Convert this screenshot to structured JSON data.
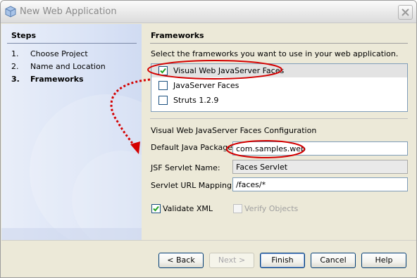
{
  "window": {
    "title": "New Web Application"
  },
  "steps": {
    "heading": "Steps",
    "items": [
      {
        "number": "1.",
        "label": "Choose Project",
        "current": false
      },
      {
        "number": "2.",
        "label": "Name and Location",
        "current": false
      },
      {
        "number": "3.",
        "label": "Frameworks",
        "current": true
      }
    ]
  },
  "frameworks": {
    "heading": "Frameworks",
    "instructions": "Select the frameworks you want to use in your web application.",
    "items": [
      {
        "label": "Visual Web JavaServer Faces",
        "checked": true,
        "selected": true
      },
      {
        "label": "JavaServer Faces",
        "checked": false,
        "selected": false
      },
      {
        "label": "Struts 1.2.9",
        "checked": false,
        "selected": false
      }
    ]
  },
  "config": {
    "heading": "Visual Web JavaServer Faces Configuration",
    "default_package_label": "Default Java Package:",
    "default_package_value": "com.samples.web",
    "servlet_name_label": "JSF Servlet Name:",
    "servlet_name_value": "Faces Servlet",
    "url_mapping_label": "Servlet URL Mapping:",
    "url_mapping_value": "/faces/*",
    "validate_xml_label": "Validate XML",
    "validate_xml_checked": true,
    "verify_objects_label": "Verify Objects",
    "verify_objects_checked": false
  },
  "buttons": {
    "back": "< Back",
    "next": "Next >",
    "finish": "Finish",
    "cancel": "Cancel",
    "help": "Help"
  },
  "colors": {
    "annotation": "#d40000",
    "selection": "#e3e3e3",
    "check": "#21a121"
  },
  "icons": {
    "app": "netbeans-cube-icon",
    "close": "close-icon",
    "check": "checkmark-icon"
  }
}
